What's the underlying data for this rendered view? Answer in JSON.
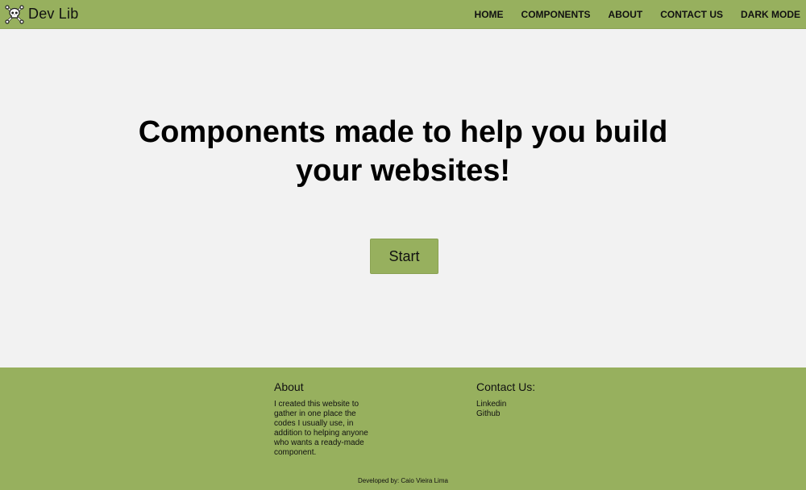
{
  "navbar": {
    "brand": "Dev Lib",
    "logo_icon": "skull-crossbones-icon",
    "links": [
      "HOME",
      "COMPONENTS",
      "ABOUT",
      "CONTACT US",
      "DARK MODE"
    ]
  },
  "hero": {
    "headline": "Components made to help you build your websites!",
    "start_label": "Start"
  },
  "footer": {
    "about": {
      "heading": "About",
      "text": "I created this website to gather in one place the codes I usually use, in addition to helping anyone who wants a ready-made component."
    },
    "contact": {
      "heading": "Contact Us:",
      "links": [
        "Linkedin",
        "Github"
      ]
    },
    "credit": "Developed by: Caio Vieira Lima"
  },
  "colors": {
    "accent": "#97b05e",
    "background": "#f2f2f2",
    "text": "#000000"
  }
}
